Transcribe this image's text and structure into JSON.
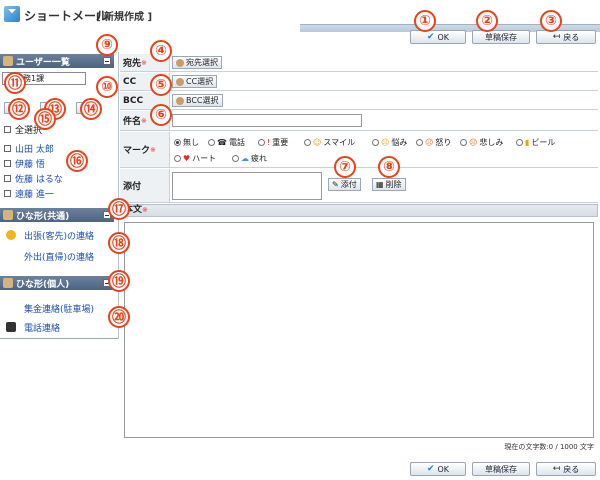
{
  "window": {
    "title": "ショートメール",
    "subtitle": "[ 新規作成 ]"
  },
  "toolbar": {
    "ok_label": "OK",
    "draft_label": "草稿保存",
    "back_label": "戻る"
  },
  "callouts": [
    "①",
    "②",
    "③",
    "④",
    "⑤",
    "⑥",
    "⑦",
    "⑧",
    "⑨",
    "⑩",
    "⑪",
    "⑫",
    "⑬",
    "⑭",
    "⑮",
    "⑯",
    "⑰",
    "⑱",
    "⑲",
    "⑳"
  ],
  "sidebar": {
    "users_header": "ユーザー一覧",
    "dept_select": "総務1課",
    "small_buttons": [
      "選択",
      "",
      "CC"
    ],
    "select_all": "全選択",
    "users": [
      "山田 太郎",
      "伊藤 悟",
      "佐藤 はるな",
      "遠藤 進一"
    ],
    "shared_templates_header": "ひな形(共通)",
    "shared_templates": [
      "出張(客先)の連絡",
      "外出(直帰)の連絡"
    ],
    "personal_templates_header": "ひな形(個人)",
    "personal_templates": [
      "集金連絡(駐車場)",
      "電話連絡"
    ]
  },
  "form": {
    "to_label": "宛先",
    "to_button": "宛先選択",
    "cc_label": "CC",
    "cc_button": "CC選択",
    "bcc_label": "BCC",
    "bcc_button": "BCC選択",
    "subject_label": "件名",
    "mark_label": "マーク",
    "marks": [
      "無し",
      "電話",
      "重要",
      "スマイル",
      "悩み",
      "怒り",
      "悲しみ",
      "ビール",
      "ハート",
      "疲れ"
    ],
    "attach_label": "添付",
    "attach_button": "添付",
    "delete_button": "削除",
    "body_label": "本文",
    "required_mark": "※",
    "char_counter": "現在の文字数:0 / 1000 文字"
  }
}
